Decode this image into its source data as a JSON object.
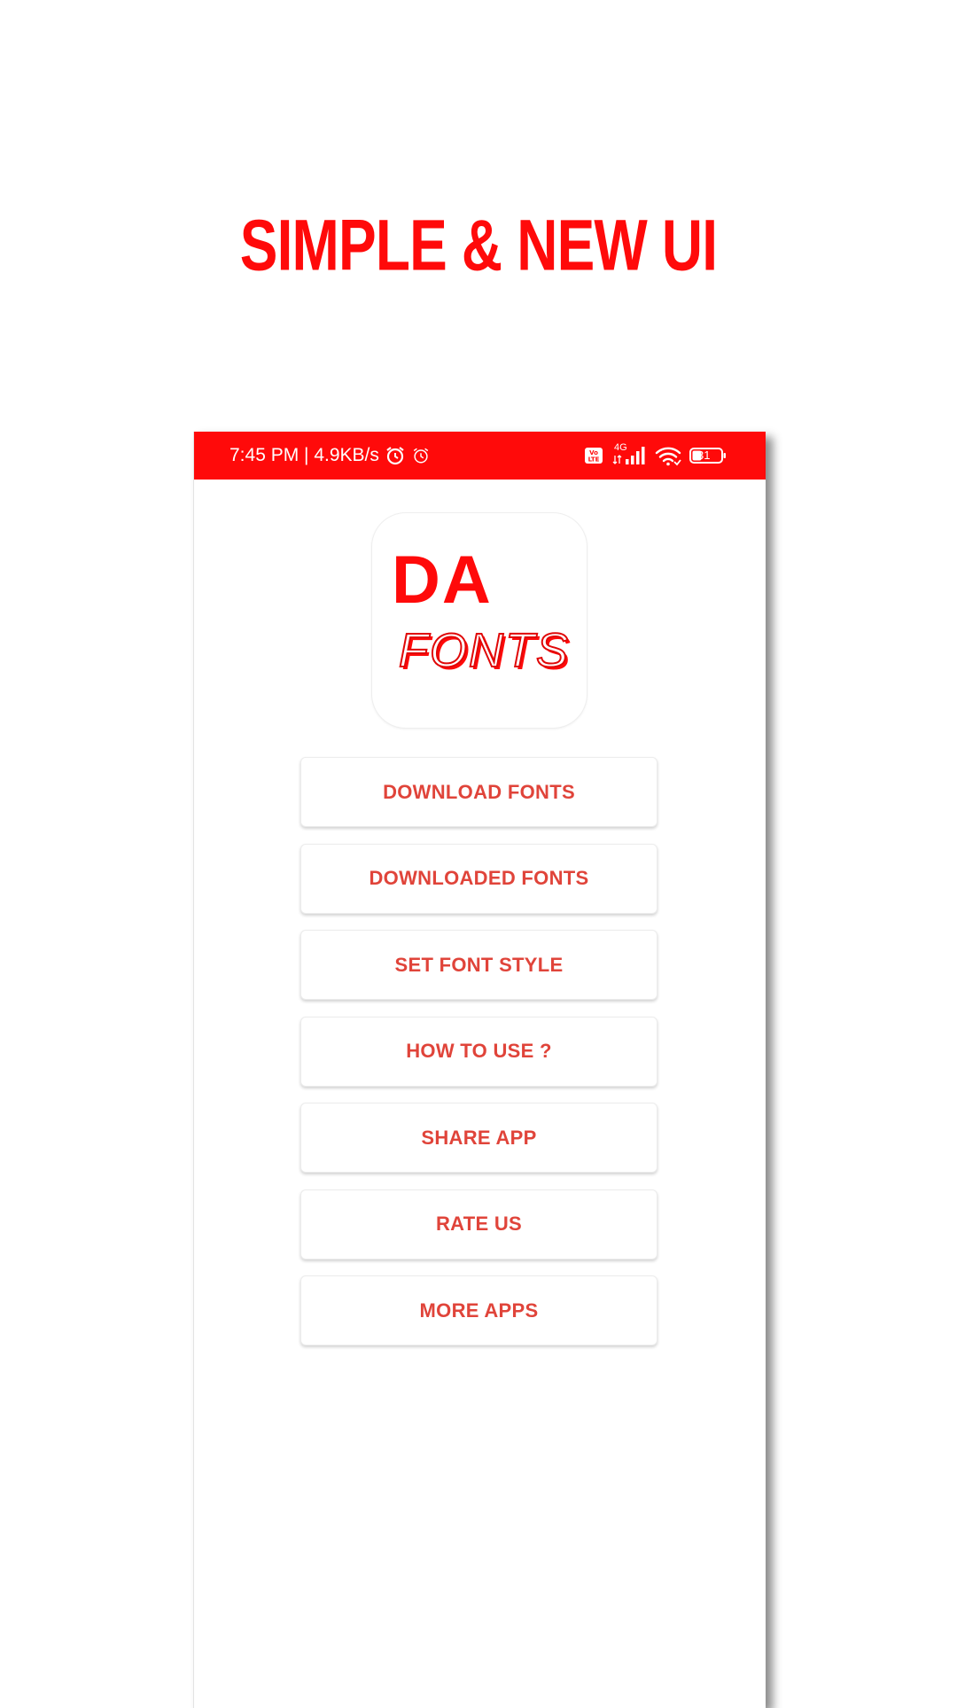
{
  "headline": "SIMPLE & NEW UI",
  "status_bar": {
    "time_speed": "7:45 PM | 4.9KB/s",
    "network_label": "4G",
    "battery_level": "31",
    "background_color": "#ff0a0a"
  },
  "logo": {
    "line1": "DA",
    "line2": "FONTS"
  },
  "menu": [
    {
      "label": "DOWNLOAD FONTS"
    },
    {
      "label": "DOWNLOADED FONTS"
    },
    {
      "label": "SET FONT STYLE"
    },
    {
      "label": "HOW TO USE ?"
    },
    {
      "label": "SHARE APP"
    },
    {
      "label": "RATE US"
    },
    {
      "label": "MORE APPS"
    }
  ],
  "colors": {
    "accent": "#ff0a0a",
    "button_text": "#e0443a"
  },
  "icons": [
    "alarm-clock-icon",
    "alarm-icon",
    "volte-icon",
    "signal-icon",
    "wifi-icon",
    "battery-icon"
  ]
}
